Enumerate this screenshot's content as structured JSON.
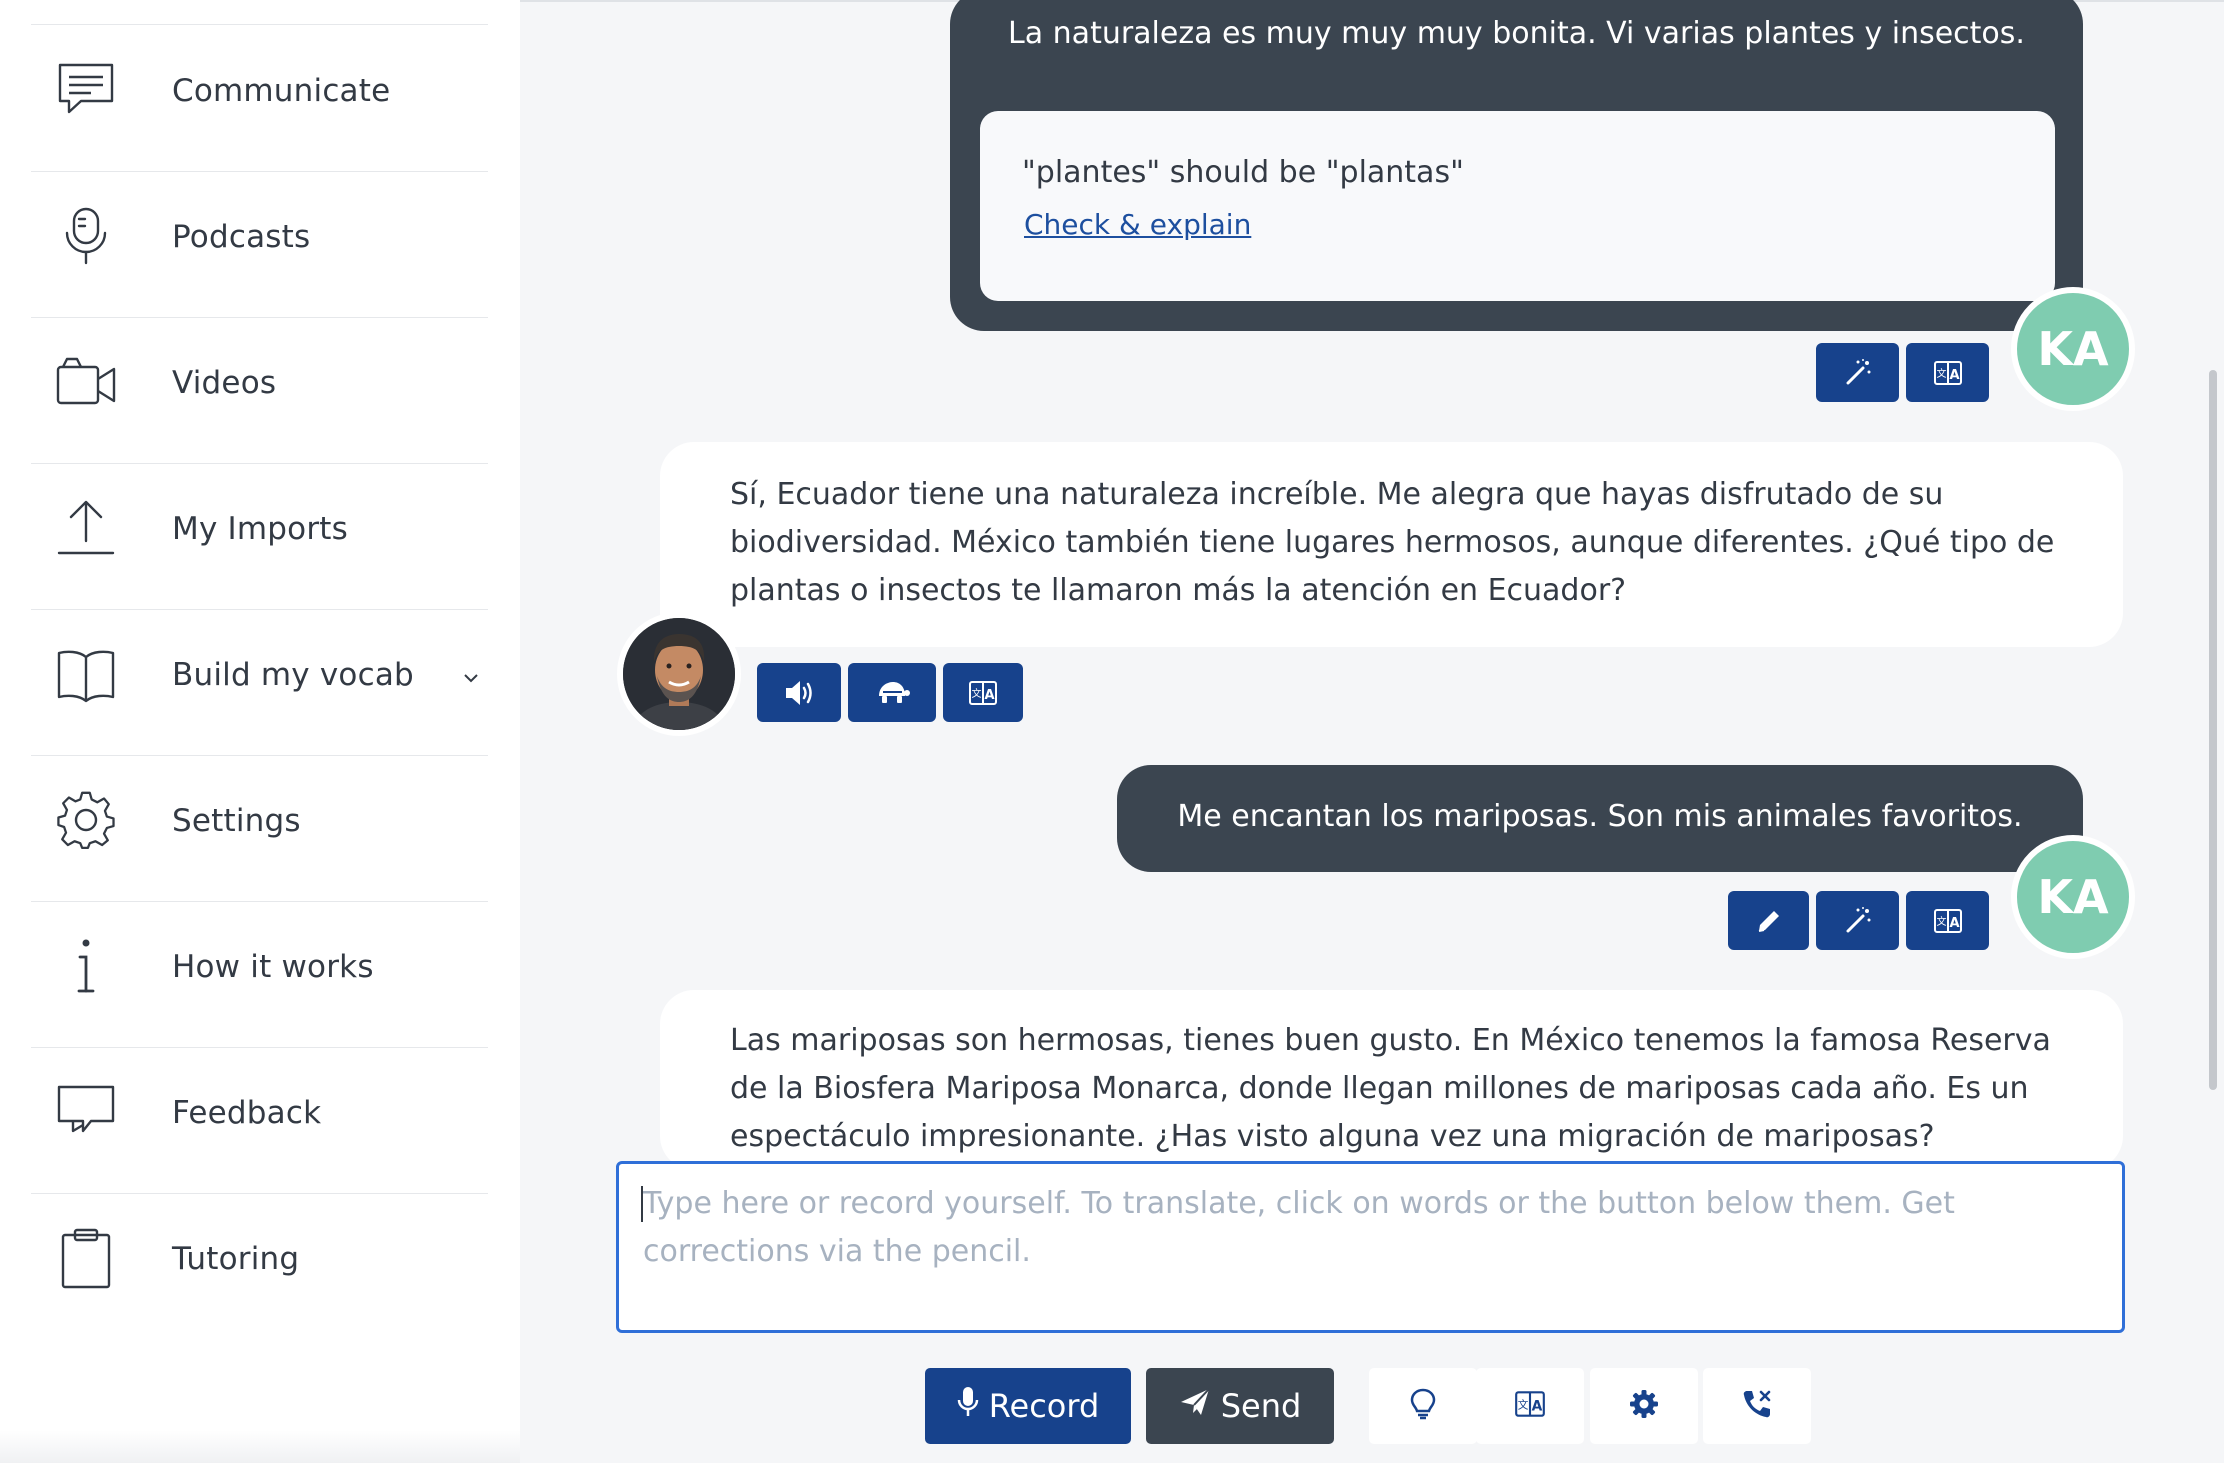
{
  "sidebar": {
    "items": [
      {
        "label": "Communicate",
        "icon": "chat-icon"
      },
      {
        "label": "Podcasts",
        "icon": "microphone-icon"
      },
      {
        "label": "Videos",
        "icon": "video-camera-icon"
      },
      {
        "label": "My Imports",
        "icon": "upload-icon"
      },
      {
        "label": "Build my vocab",
        "icon": "book-icon",
        "has_dropdown": true
      },
      {
        "label": "Settings",
        "icon": "gear-icon"
      },
      {
        "label": "How it works",
        "icon": "info-icon"
      },
      {
        "label": "Feedback",
        "icon": "feedback-icon"
      },
      {
        "label": "Tutoring",
        "icon": "clipboard-icon"
      }
    ]
  },
  "chat": {
    "messages": [
      {
        "role": "user",
        "text": "La naturaleza es muy muy muy bonita. Vi varias plantes y insectos.",
        "correction": {
          "text": "\"plantes\" should be \"plantas\"",
          "link_label": "Check & explain"
        },
        "avatar": "KA"
      },
      {
        "role": "tutor",
        "text": "Sí, Ecuador tiene una naturaleza increíble. Me alegra que hayas disfrutado de su biodiversidad. México también tiene lugares hermosos, aunque diferentes. ¿Qué tipo de plantas o insectos te llamaron más la atención en Ecuador?"
      },
      {
        "role": "user",
        "text": "Me encantan los mariposas. Son mis animales favoritos.",
        "avatar": "KA"
      },
      {
        "role": "tutor",
        "text": "Las mariposas son hermosas, tienes buen gusto. En México tenemos la famosa Reserva de la Biosfera Mariposa Monarca, donde llegan millones de mariposas cada año. Es un espectáculo impresionante. ¿Has visto alguna vez una migración de mariposas?"
      }
    ]
  },
  "composer": {
    "placeholder": "Type here or record yourself. To translate, click on words or the button below them. Get corrections via the pencil.",
    "record_label": "Record",
    "send_label": "Send"
  },
  "colors": {
    "primary_button": "#17428c",
    "dark_button": "#3b4550",
    "user_bubble": "#3b4550",
    "user_avatar": "#7fccb0",
    "input_border": "#2f6fd8"
  }
}
